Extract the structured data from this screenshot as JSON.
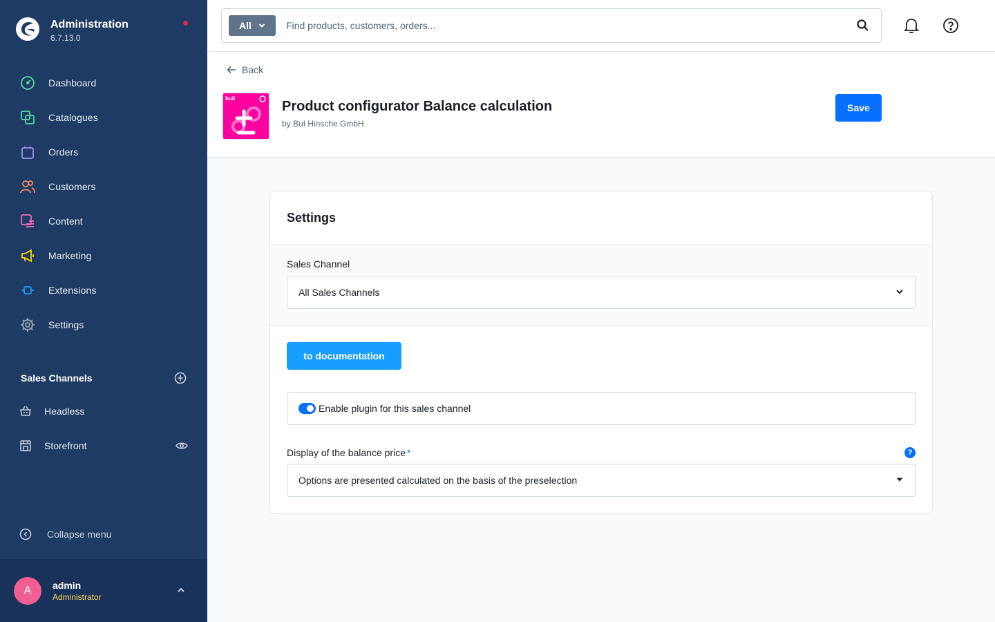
{
  "app": {
    "title": "Administration",
    "version": "6.7.13.0"
  },
  "sidebar": {
    "items": [
      {
        "label": "Dashboard",
        "icon": "dashboard-icon",
        "color": "#57d9a3"
      },
      {
        "label": "Catalogues",
        "icon": "catalogue-icon",
        "color": "#57d9a3"
      },
      {
        "label": "Orders",
        "icon": "orders-icon",
        "color": "#a092f0"
      },
      {
        "label": "Customers",
        "icon": "customers-icon",
        "color": "#f88962"
      },
      {
        "label": "Content",
        "icon": "content-icon",
        "color": "#ff68b4"
      },
      {
        "label": "Marketing",
        "icon": "marketing-icon",
        "color": "#ffd700"
      },
      {
        "label": "Extensions",
        "icon": "extensions-icon",
        "color": "#189eff"
      },
      {
        "label": "Settings",
        "icon": "settings-icon",
        "color": "#9aa8b5"
      }
    ],
    "sales_channels_title": "Sales Channels",
    "sales_channels": [
      {
        "label": "Headless",
        "icon": "basket-icon"
      },
      {
        "label": "Storefront",
        "icon": "storefront-icon"
      }
    ],
    "collapse_label": "Collapse menu"
  },
  "user": {
    "initial": "A",
    "name": "admin",
    "role": "Administrator"
  },
  "search": {
    "type_label": "All",
    "placeholder": "Find products, customers, orders..."
  },
  "header": {
    "back_label": "Back",
    "plugin_title": "Product configurator Balance calculation",
    "plugin_vendor": "by BuI Hinsche GmbH",
    "plugin_logo_text": "buii",
    "save_label": "Save"
  },
  "card": {
    "title": "Settings",
    "sales_channel_label": "Sales Channel",
    "sales_channel_value": "All Sales Channels",
    "doc_button_label": "to documentation",
    "enable_label": "Enable plugin for this sales channel",
    "enable_value": true,
    "balance_label": "Display of the balance price",
    "balance_required_mark": "*",
    "balance_help_mark": "?",
    "balance_value": "Options are presented calculated on the basis of the preselection"
  },
  "colors": {
    "sidebar_bg": "#1e3b63",
    "primary": "#0870ff",
    "doc_button": "#189eff",
    "avatar": "#f25d93",
    "role_text": "#ffd65c",
    "notification_dot": "#de294c",
    "plugin_logo": "#ff00a0"
  }
}
